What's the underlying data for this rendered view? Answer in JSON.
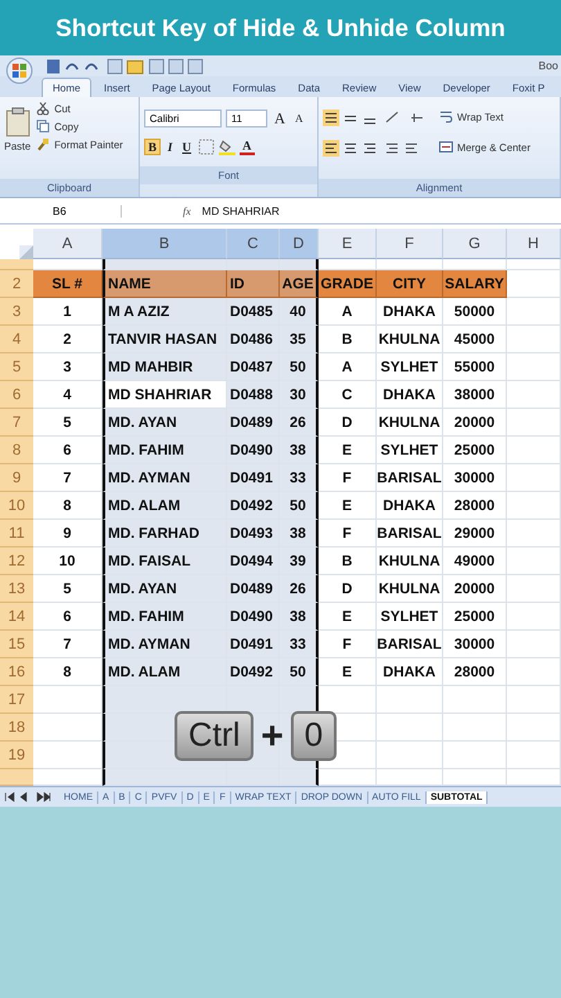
{
  "banner": {
    "title": "Shortcut Key of Hide & Unhide Column"
  },
  "quick_access": {
    "title_fragment": "Boo"
  },
  "ribbon_tabs": [
    {
      "label": "Home",
      "selected": true
    },
    {
      "label": "Insert",
      "selected": false
    },
    {
      "label": "Page Layout",
      "selected": false
    },
    {
      "label": "Formulas",
      "selected": false
    },
    {
      "label": "Data",
      "selected": false
    },
    {
      "label": "Review",
      "selected": false
    },
    {
      "label": "View",
      "selected": false
    },
    {
      "label": "Developer",
      "selected": false
    },
    {
      "label": "Foxit P",
      "selected": false
    }
  ],
  "clipboard": {
    "paste": "Paste",
    "cut": "Cut",
    "copy": "Copy",
    "format_painter": "Format Painter",
    "label": "Clipboard"
  },
  "font": {
    "name": "Calibri",
    "size": "11",
    "grow": "A",
    "shrink": "A",
    "styles": [
      {
        "label": "B",
        "selected": true
      },
      {
        "label": "I",
        "selected": false
      },
      {
        "label": "U",
        "selected": false
      }
    ],
    "color_button": "A",
    "label": "Font"
  },
  "alignment": {
    "wrap_text": "Wrap Text",
    "merge_center": "Merge & Center",
    "label": "Alignment"
  },
  "formula_bar": {
    "name_box": "B6",
    "function_label": "fx",
    "formula": "MD SHAHRIAR"
  },
  "columns": [
    {
      "label": "A",
      "selected": false
    },
    {
      "label": "B",
      "selected": true
    },
    {
      "label": "C",
      "selected": true
    },
    {
      "label": "D",
      "selected": true
    },
    {
      "label": "E",
      "selected": false
    },
    {
      "label": "F",
      "selected": false
    },
    {
      "label": "G",
      "selected": false
    },
    {
      "label": "H",
      "selected": false
    }
  ],
  "rows": [
    {
      "number": "2",
      "kind": "header",
      "selected": false,
      "cells": [
        "SL #",
        "NAME",
        "ID",
        "AGE",
        "GRADE",
        "CITY",
        "SALARY"
      ]
    },
    {
      "number": "3",
      "kind": "data",
      "selected": false,
      "cells": [
        "1",
        "M A AZIZ",
        "D0485",
        "40",
        "A",
        "DHAKA",
        "50000"
      ]
    },
    {
      "number": "4",
      "kind": "data",
      "selected": false,
      "cells": [
        "2",
        "TANVIR HASAN",
        "D0486",
        "35",
        "B",
        "KHULNA",
        "45000"
      ]
    },
    {
      "number": "5",
      "kind": "data",
      "selected": false,
      "cells": [
        "3",
        "MD MAHBIR",
        "D0487",
        "50",
        "A",
        "SYLHET",
        "55000"
      ]
    },
    {
      "number": "6",
      "kind": "data",
      "selected": true,
      "cells": [
        "4",
        "MD SHAHRIAR",
        "D0488",
        "30",
        "C",
        "DHAKA",
        "38000"
      ]
    },
    {
      "number": "7",
      "kind": "data",
      "selected": false,
      "cells": [
        "5",
        "MD. AYAN",
        "D0489",
        "26",
        "D",
        "KHULNA",
        "20000"
      ]
    },
    {
      "number": "8",
      "kind": "data",
      "selected": false,
      "cells": [
        "6",
        "MD. FAHIM",
        "D0490",
        "38",
        "E",
        "SYLHET",
        "25000"
      ]
    },
    {
      "number": "9",
      "kind": "data",
      "selected": false,
      "cells": [
        "7",
        "MD. AYMAN",
        "D0491",
        "33",
        "F",
        "BARISAL",
        "30000"
      ]
    },
    {
      "number": "10",
      "kind": "data",
      "selected": false,
      "cells": [
        "8",
        "MD. ALAM",
        "D0492",
        "50",
        "E",
        "DHAKA",
        "28000"
      ]
    },
    {
      "number": "11",
      "kind": "data",
      "selected": false,
      "cells": [
        "9",
        "MD. FARHAD",
        "D0493",
        "38",
        "F",
        "BARISAL",
        "29000"
      ]
    },
    {
      "number": "12",
      "kind": "data",
      "selected": false,
      "cells": [
        "10",
        "MD. FAISAL",
        "D0494",
        "39",
        "B",
        "KHULNA",
        "49000"
      ]
    },
    {
      "number": "13",
      "kind": "data",
      "selected": false,
      "cells": [
        "5",
        "MD. AYAN",
        "D0489",
        "26",
        "D",
        "KHULNA",
        "20000"
      ]
    },
    {
      "number": "14",
      "kind": "data",
      "selected": false,
      "cells": [
        "6",
        "MD. FAHIM",
        "D0490",
        "38",
        "E",
        "SYLHET",
        "25000"
      ]
    },
    {
      "number": "15",
      "kind": "data",
      "selected": false,
      "cells": [
        "7",
        "MD. AYMAN",
        "D0491",
        "33",
        "F",
        "BARISAL",
        "30000"
      ]
    },
    {
      "number": "16",
      "kind": "data",
      "selected": false,
      "cells": [
        "8",
        "MD. ALAM",
        "D0492",
        "50",
        "E",
        "DHAKA",
        "28000"
      ]
    },
    {
      "number": "17",
      "kind": "empty",
      "selected": false
    },
    {
      "number": "18",
      "kind": "empty",
      "selected": false
    },
    {
      "number": "19",
      "kind": "empty",
      "selected": false
    }
  ],
  "shortcut": {
    "keys": [
      "Ctrl",
      "0"
    ],
    "joiner": "+"
  },
  "sheet_tabs": [
    {
      "label": "HOME",
      "selected": false
    },
    {
      "label": "A",
      "selected": false
    },
    {
      "label": "B",
      "selected": false
    },
    {
      "label": "C",
      "selected": false
    },
    {
      "label": "PVFV",
      "selected": false
    },
    {
      "label": "D",
      "selected": false
    },
    {
      "label": "E",
      "selected": false
    },
    {
      "label": "F",
      "selected": false
    },
    {
      "label": "WRAP TEXT",
      "selected": false
    },
    {
      "label": "DROP DOWN",
      "selected": false
    },
    {
      "label": "AUTO FILL",
      "selected": false
    },
    {
      "label": "SUBTOTAL",
      "selected": true
    }
  ]
}
